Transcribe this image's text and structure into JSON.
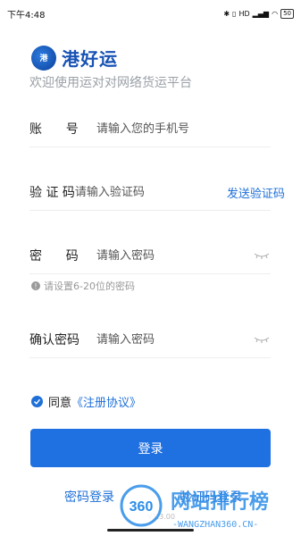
{
  "status_bar": {
    "time": "下午4:48",
    "signal_text": "HD",
    "battery": "50"
  },
  "header": {
    "logo_mark_text": "港",
    "app_name": "港好运",
    "subtitle": "欢迎使用运对对网络货运平台"
  },
  "form": {
    "account": {
      "label": "账      号",
      "placeholder": "请输入您的手机号"
    },
    "code": {
      "label": "验 证 码",
      "placeholder": "请输入验证码",
      "send_label": "发送验证码"
    },
    "password": {
      "label": "密      码",
      "placeholder": "请输入密码"
    },
    "password_hint": "请设置6-20位的密码",
    "confirm": {
      "label": "确认密码",
      "placeholder": "请输入密码"
    }
  },
  "agreement": {
    "prefix": "同意",
    "link": "《注册协议》",
    "checked": true
  },
  "login_button": "登录",
  "links": {
    "password_login": "密码登录",
    "code_login": "验证码登录"
  },
  "version": "V1.3.00",
  "watermark": {
    "logo": "360",
    "title": "网站排行榜",
    "url": "-WANGZHAN360.CN-"
  },
  "colors": {
    "brand_blue": "#1f70e0",
    "logo_blue": "#1752b4"
  }
}
